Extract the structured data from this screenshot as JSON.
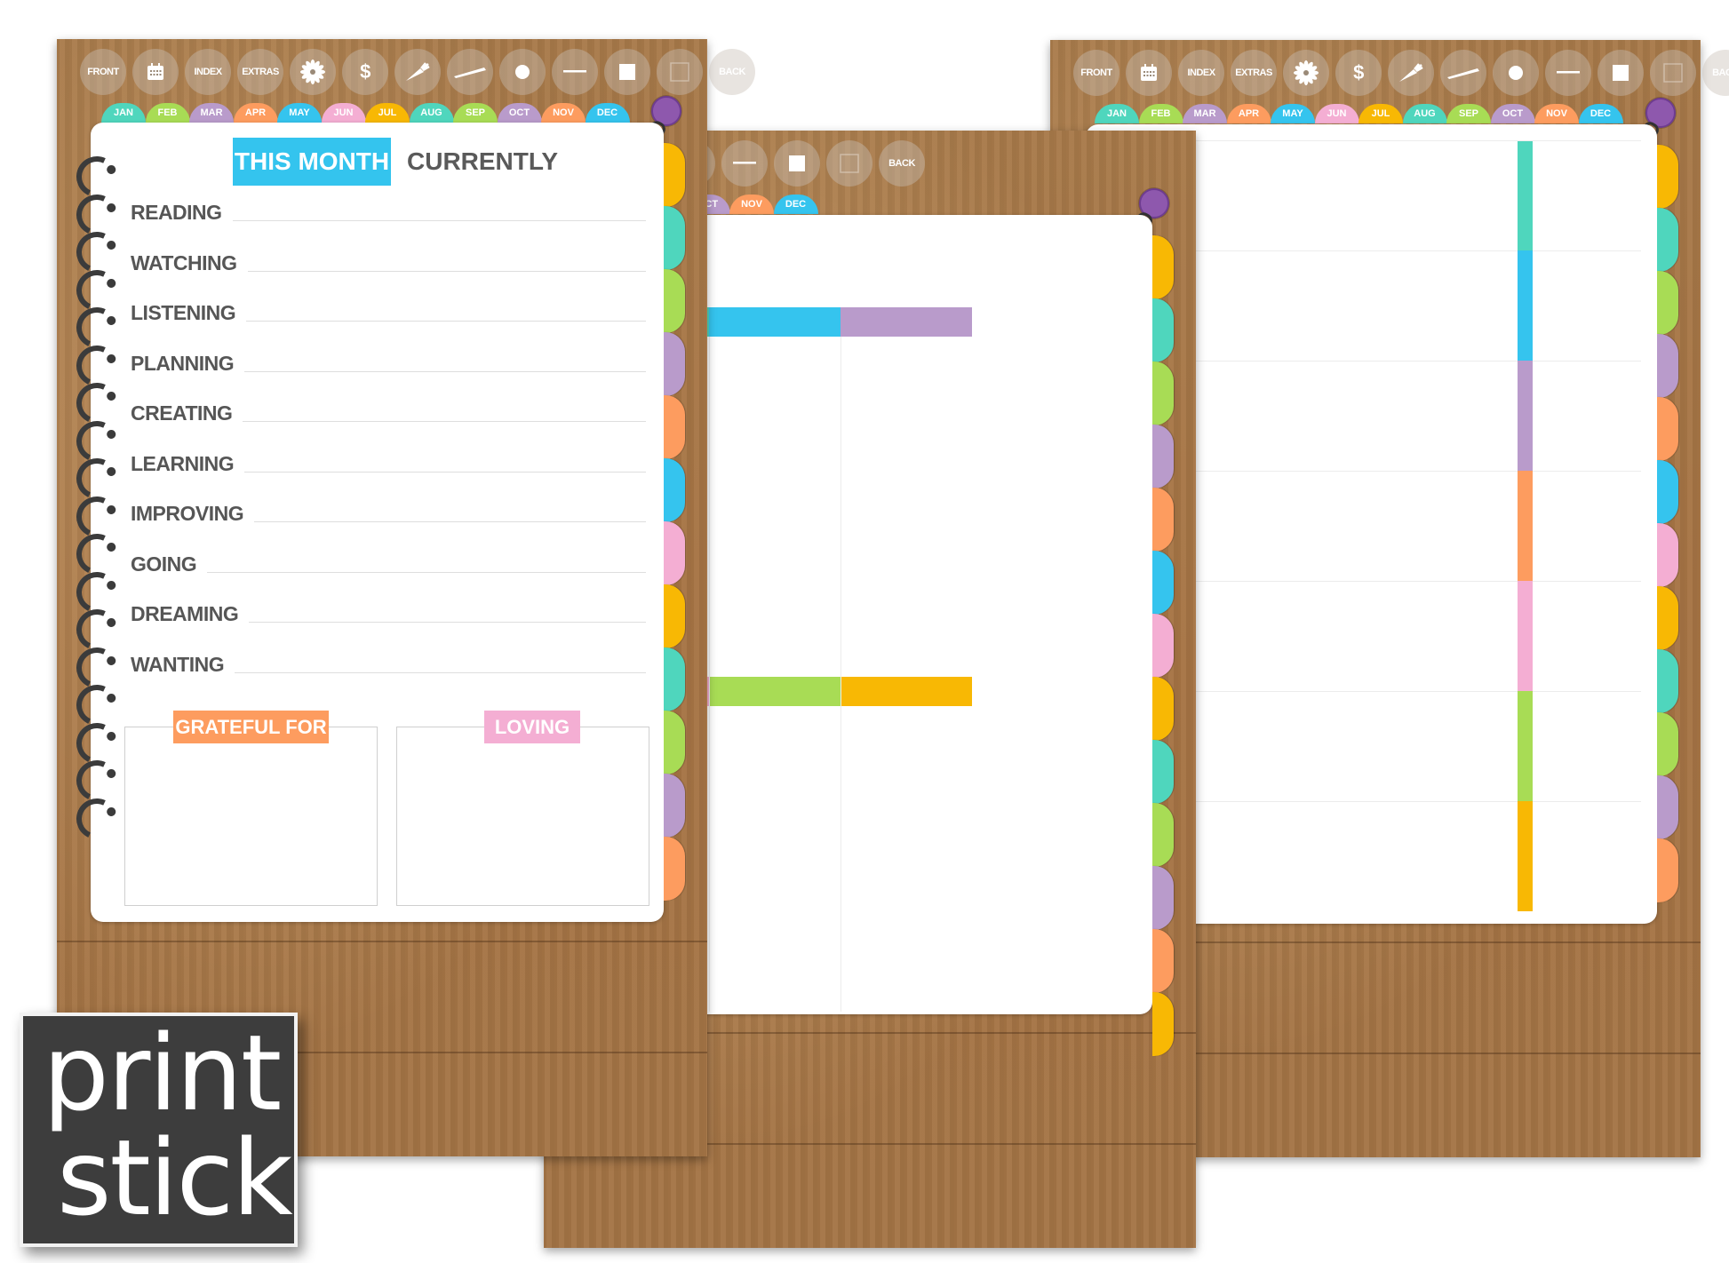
{
  "toolbar": {
    "buttons": [
      {
        "label": "FRONT",
        "icon": null
      },
      {
        "label": "",
        "icon": "calendar-icon"
      },
      {
        "label": "INDEX",
        "icon": null
      },
      {
        "label": "EXTRAS",
        "icon": null
      },
      {
        "label": "",
        "icon": "flower-icon"
      },
      {
        "label": "$",
        "icon": "dollar-icon"
      },
      {
        "label": "",
        "icon": "carrot-icon"
      },
      {
        "label": "",
        "icon": "pen-icon"
      },
      {
        "label": "",
        "icon": "dot-icon"
      },
      {
        "label": "",
        "icon": "dash-icon"
      },
      {
        "label": "",
        "icon": "filled-square-icon"
      },
      {
        "label": "",
        "icon": "empty-square-icon"
      },
      {
        "label": "BACK",
        "icon": null
      }
    ]
  },
  "months": [
    {
      "label": "JAN",
      "color": "#4fd6bd"
    },
    {
      "label": "FEB",
      "color": "#a8dc55"
    },
    {
      "label": "MAR",
      "color": "#b99bcb"
    },
    {
      "label": "APR",
      "color": "#fd9c5f"
    },
    {
      "label": "MAY",
      "color": "#35c4ee"
    },
    {
      "label": "JUN",
      "color": "#f4aed3"
    },
    {
      "label": "JUL",
      "color": "#f8b804"
    },
    {
      "label": "AUG",
      "color": "#4fd6bd"
    },
    {
      "label": "SEP",
      "color": "#a8dc55"
    },
    {
      "label": "OCT",
      "color": "#b99bcb"
    },
    {
      "label": "NOV",
      "color": "#fd9c5f"
    },
    {
      "label": "DEC",
      "color": "#35c4ee"
    }
  ],
  "side_tab_colors": [
    "#f8b804",
    "#4fd6bd",
    "#a8dc55",
    "#b99bcb",
    "#fd9c5f",
    "#35c4ee",
    "#f4aed3",
    "#f8b804",
    "#4fd6bd",
    "#a8dc55",
    "#b99bcb",
    "#fd9c5f"
  ],
  "page1": {
    "this_month": "THIS MONTH",
    "currently": "CURRENTLY",
    "items": [
      "READING",
      "WATCHING",
      "LISTENING",
      "PLANNING",
      "CREATING",
      "LEARNING",
      "IMPROVING",
      "GOING",
      "DREAMING",
      "WANTING"
    ],
    "grateful_label": "GRATEFUL FOR",
    "grateful_color": "#fd9c5f",
    "loving_label": "LOVING",
    "loving_color": "#f4aed3"
  },
  "page2": {
    "row1_colors": [
      "#f8b804",
      "#4fd6bd",
      "#35c4ee",
      "#b99bcb"
    ],
    "row2_colors": [
      "#fd9c5f",
      "#f4aed3",
      "#a8dc55",
      "#f8b804"
    ]
  },
  "page3": {
    "column_colors": [
      "#4fd6bd",
      "#35c4ee",
      "#b99bcb",
      "#fd9c5f",
      "#f4aed3",
      "#a8dc55",
      "#f8b804"
    ]
  },
  "logo": {
    "line1": "print",
    "line2": "stick"
  },
  "clip_color": "#8e58ad"
}
